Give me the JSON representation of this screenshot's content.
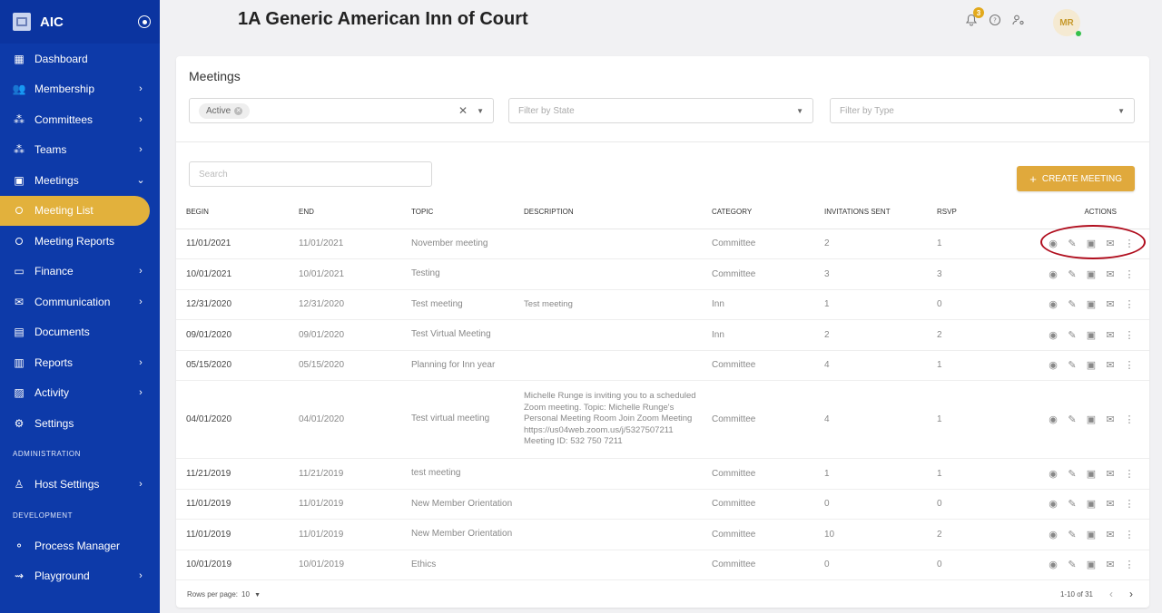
{
  "app": {
    "name": "AIC",
    "org_title": "1A Generic American Inn of Court"
  },
  "sidebar": {
    "items": [
      {
        "label": "Dashboard",
        "icon": "dashboard-icon"
      },
      {
        "label": "Membership",
        "icon": "people-icon",
        "chevron": true
      },
      {
        "label": "Committees",
        "icon": "group-icon",
        "chevron": true
      },
      {
        "label": "Teams",
        "icon": "group-icon",
        "chevron": true
      },
      {
        "label": "Meetings",
        "icon": "calendar-icon",
        "chevron_down": true
      },
      {
        "label": "Meeting List",
        "active": true
      },
      {
        "label": "Meeting Reports"
      },
      {
        "label": "Finance",
        "icon": "money-icon",
        "chevron": true
      },
      {
        "label": "Communication",
        "icon": "mail-icon",
        "chevron": true
      },
      {
        "label": "Documents",
        "icon": "document-icon"
      },
      {
        "label": "Reports",
        "icon": "chart-icon",
        "chevron": true
      },
      {
        "label": "Activity",
        "icon": "activity-icon",
        "chevron": true
      },
      {
        "label": "Settings",
        "icon": "gear-icon"
      }
    ],
    "section_admin": "ADMINISTRATION",
    "admin_items": [
      {
        "label": "Host Settings",
        "icon": "user-cog-icon",
        "chevron": true
      }
    ],
    "section_dev": "DEVELOPMENT",
    "dev_items": [
      {
        "label": "Process Manager",
        "icon": "process-icon"
      },
      {
        "label": "Playground",
        "icon": "playground-icon",
        "chevron": true
      }
    ]
  },
  "header": {
    "notif_count": "3",
    "avatar_initials": "MR"
  },
  "meetings": {
    "title": "Meetings",
    "filter_status_chip": "Active",
    "filter_state_placeholder": "Filter by State",
    "filter_type_placeholder": "Filter by Type",
    "search_placeholder": "Search",
    "create_label": "CREATE MEETING",
    "columns": [
      "BEGIN",
      "END",
      "TOPIC",
      "DESCRIPTION",
      "CATEGORY",
      "INVITATIONS SENT",
      "RSVP",
      "ACTIONS"
    ],
    "rows": [
      {
        "begin": "11/01/2021",
        "end": "11/01/2021",
        "topic": "November meeting",
        "description": "",
        "category": "Committee",
        "invitations": "2",
        "rsvp": "1"
      },
      {
        "begin": "10/01/2021",
        "end": "10/01/2021",
        "topic": "Testing",
        "description": "",
        "category": "Committee",
        "invitations": "3",
        "rsvp": "3"
      },
      {
        "begin": "12/31/2020",
        "end": "12/31/2020",
        "topic": "Test meeting",
        "description": "Test meeting",
        "category": "Inn",
        "invitations": "1",
        "rsvp": "0"
      },
      {
        "begin": "09/01/2020",
        "end": "09/01/2020",
        "topic": "Test Virtual Meeting",
        "description": "",
        "category": "Inn",
        "invitations": "2",
        "rsvp": "2"
      },
      {
        "begin": "05/15/2020",
        "end": "05/15/2020",
        "topic": "Planning for Inn year",
        "description": "",
        "category": "Committee",
        "invitations": "4",
        "rsvp": "1"
      },
      {
        "begin": "04/01/2020",
        "end": "04/01/2020",
        "topic": "Test virtual meeting",
        "description": "Michelle Runge is inviting you to a scheduled Zoom meeting.   Topic: Michelle Runge's Personal Meeting Room   Join Zoom Meeting https://us04web.zoom.us/j/5327507211   Meeting ID: 532 750 7211",
        "category": "Committee",
        "invitations": "4",
        "rsvp": "1"
      },
      {
        "begin": "11/21/2019",
        "end": "11/21/2019",
        "topic": "test meeting",
        "description": "",
        "category": "Committee",
        "invitations": "1",
        "rsvp": "1"
      },
      {
        "begin": "11/01/2019",
        "end": "11/01/2019",
        "topic": "New Member Orientation",
        "description": "",
        "category": "Committee",
        "invitations": "0",
        "rsvp": "0"
      },
      {
        "begin": "11/01/2019",
        "end": "11/01/2019",
        "topic": "New Member Orientation",
        "description": "",
        "category": "Committee",
        "invitations": "10",
        "rsvp": "2"
      },
      {
        "begin": "10/01/2019",
        "end": "10/01/2019",
        "topic": "Ethics",
        "description": "",
        "category": "Committee",
        "invitations": "0",
        "rsvp": "0"
      }
    ],
    "rows_per_page_label": "Rows per page:",
    "rows_per_page_value": "10",
    "page_range": "1-10 of 31"
  },
  "colors": {
    "sidebar": "#0d3aa9",
    "accent": "#e0a93c",
    "highlight": "#b00e1e"
  }
}
